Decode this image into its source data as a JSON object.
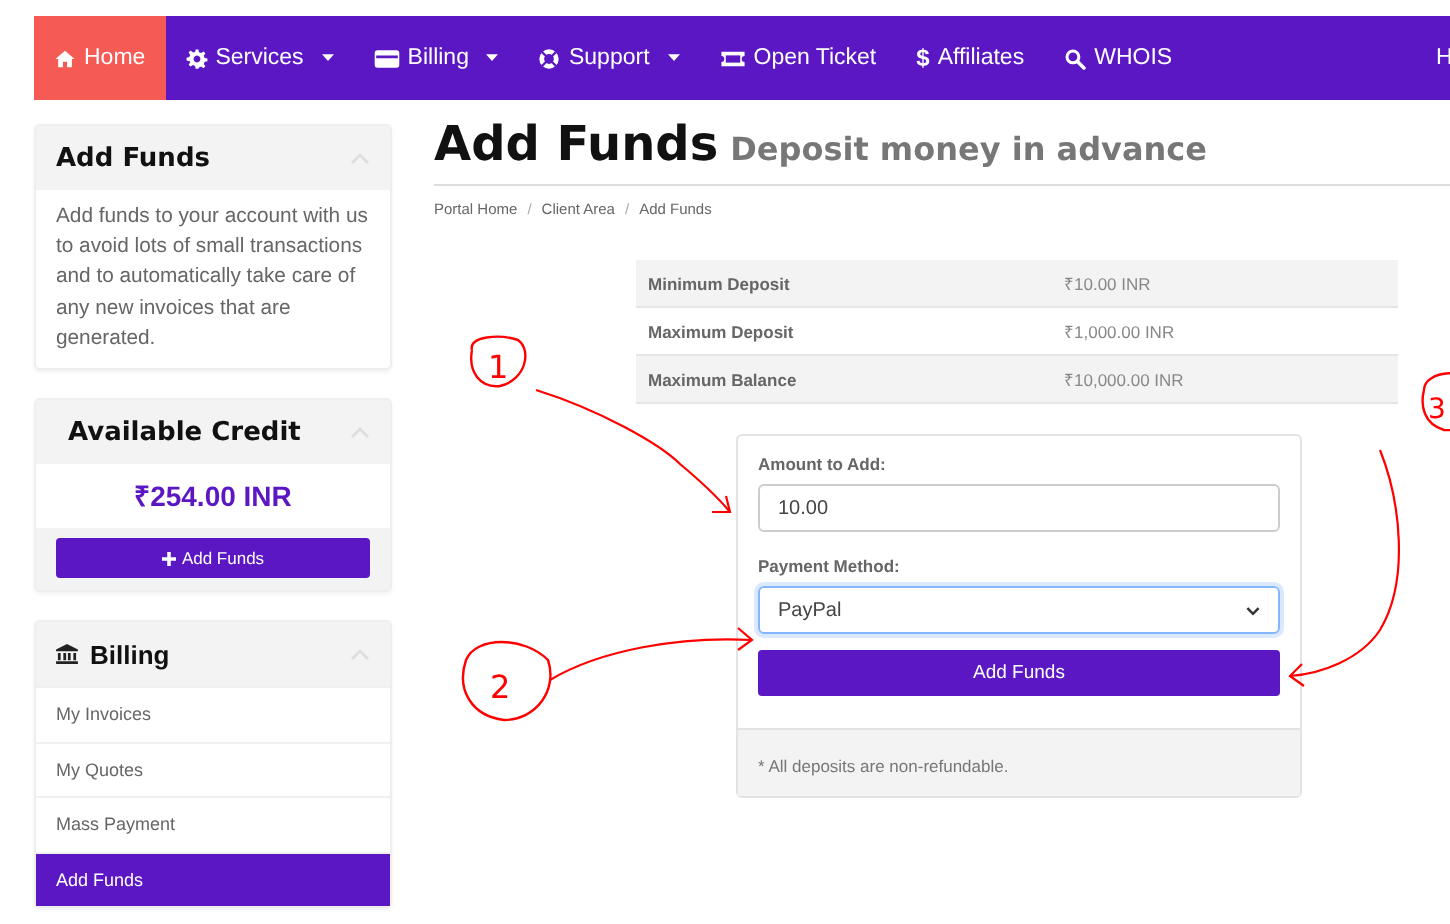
{
  "nav": {
    "items": [
      {
        "label": "Home",
        "kind": "home",
        "dropdown": false,
        "selected": true
      },
      {
        "label": "Services",
        "kind": "gear",
        "dropdown": true,
        "selected": false
      },
      {
        "label": "Billing",
        "kind": "card",
        "dropdown": true,
        "selected": false
      },
      {
        "label": "Support",
        "kind": "lifebuoy",
        "dropdown": true,
        "selected": false
      },
      {
        "label": "Open Ticket",
        "kind": "ticket",
        "dropdown": false,
        "selected": false
      },
      {
        "label": "Affiliates",
        "kind": "glyph",
        "glyph": "$",
        "dropdown": false,
        "selected": false
      },
      {
        "label": "WHOIS",
        "kind": "search",
        "dropdown": false,
        "selected": false
      }
    ],
    "right_cut": "H"
  },
  "sidebar": {
    "info": {
      "title": "Add Funds",
      "text": "Add funds to your account with us to avoid lots of small transactions and to automatically take care of any new invoices that are generated."
    },
    "credit": {
      "title": "Available Credit",
      "amount": "₹254.00 INR",
      "button": "Add Funds"
    },
    "billing": {
      "title": "Billing",
      "items": [
        {
          "label": "My Invoices",
          "selected": false
        },
        {
          "label": "My Quotes",
          "selected": false
        },
        {
          "label": "Mass Payment",
          "selected": false
        },
        {
          "label": "Add Funds",
          "selected": true
        }
      ]
    }
  },
  "page": {
    "title": "Add Funds",
    "subtitle": "Deposit money in advance",
    "breadcrumb": [
      "Portal Home",
      "Client Area",
      "Add Funds"
    ],
    "breadcrumb_separator": "/",
    "limits": [
      {
        "label": "Minimum Deposit",
        "value": "₹10.00 INR"
      },
      {
        "label": "Maximum Deposit",
        "value": "₹1,000.00 INR"
      },
      {
        "label": "Maximum Balance",
        "value": "₹10,000.00 INR"
      }
    ],
    "form": {
      "amount_label": "Amount to Add:",
      "amount_value": "10.00",
      "method_label": "Payment Method:",
      "method_value": "PayPal",
      "button": "Add Funds",
      "note": "* All deposits are non-refundable."
    }
  },
  "annotations": [
    "1",
    "2",
    "3"
  ]
}
